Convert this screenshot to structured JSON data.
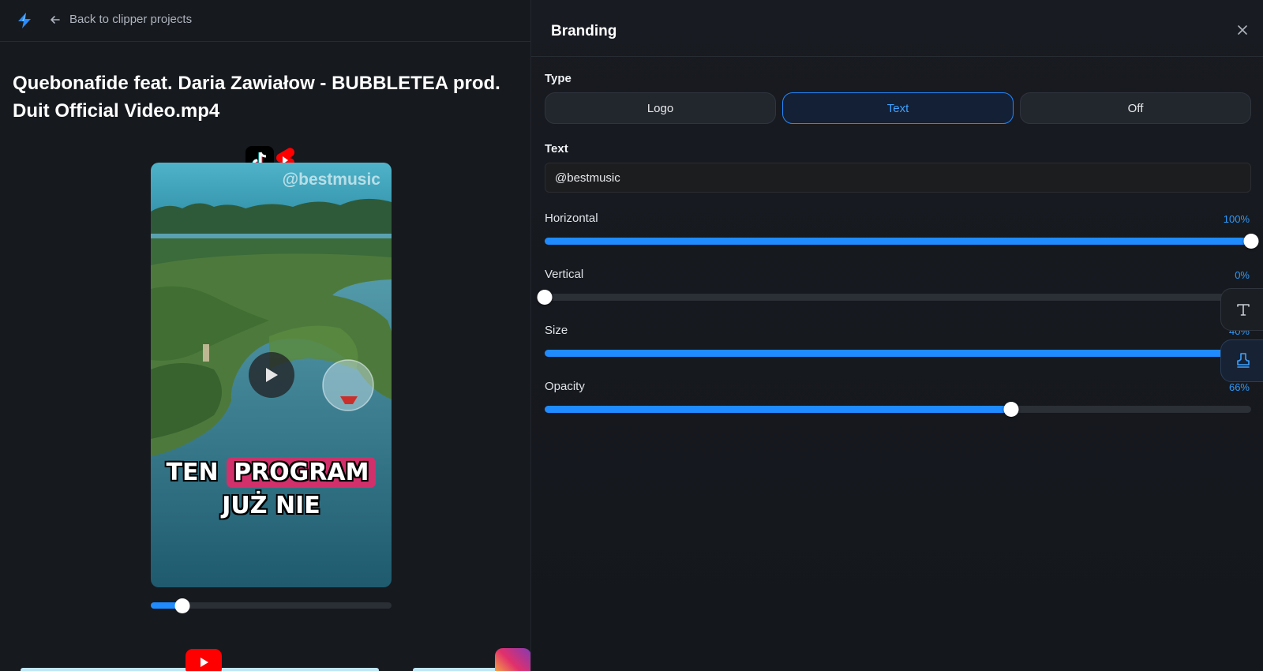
{
  "topbar": {
    "back_label": "Back to clipper projects"
  },
  "video": {
    "title": "Quebonafide feat. Daria Zawiałow - BUBBLETEA prod. Duit Official Video.mp4",
    "watermark": "@bestmusic",
    "caption_line1_a": "TEN",
    "caption_line1_highlight": "PROGRAM",
    "caption_line2": "JUŻ NIE",
    "playback_progress_percent": 13
  },
  "panel": {
    "title": "Branding",
    "type_label": "Type",
    "type_options": [
      "Logo",
      "Text",
      "Off"
    ],
    "type_selected": "Text",
    "text_label": "Text",
    "text_value": "@bestmusic",
    "sliders": {
      "horizontal": {
        "label": "Horizontal",
        "value_text": "100%",
        "value": 100
      },
      "vertical": {
        "label": "Vertical",
        "value_text": "0%",
        "value": 0
      },
      "size": {
        "label": "Size",
        "value_text": "40%",
        "value": 100
      },
      "opacity": {
        "label": "Opacity",
        "value_text": "66%",
        "value": 66
      }
    }
  },
  "icons": {
    "app_logo": "lightning-logo-icon",
    "back": "arrow-left-icon",
    "close": "close-icon",
    "play": "play-icon",
    "tiktok": "tiktok-icon",
    "shorts": "youtube-shorts-icon",
    "youtube": "youtube-icon",
    "instagram": "instagram-icon",
    "side_text_tool": "text-tool-icon",
    "side_stamp_tool": "stamp-icon"
  },
  "colors": {
    "accent": "#1f8bff",
    "background": "#15181d",
    "caption_highlight": "#d1306a"
  }
}
